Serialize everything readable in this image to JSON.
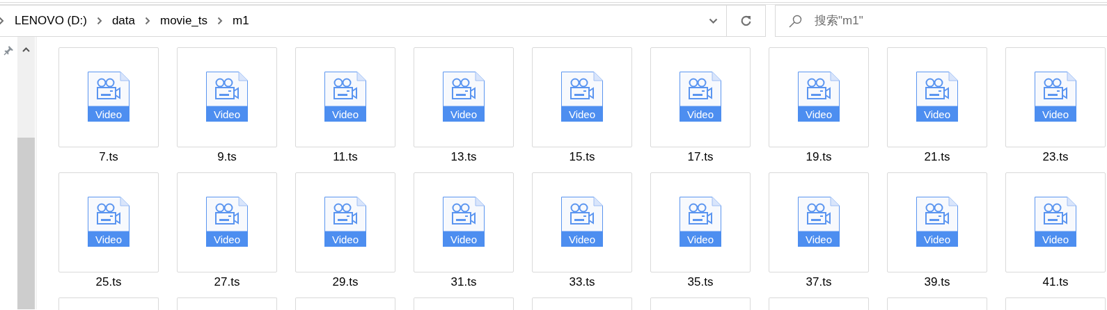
{
  "address_bar": {
    "crumbs": [
      "LENOVO (D:)",
      "data",
      "movie_ts",
      "m1"
    ]
  },
  "search": {
    "placeholder": "搜索\"m1\""
  },
  "files": [
    {
      "kind": "video",
      "name": "7.ts",
      "badge": "Video"
    },
    {
      "kind": "video",
      "name": "9.ts",
      "badge": "Video"
    },
    {
      "kind": "video",
      "name": "11.ts",
      "badge": "Video"
    },
    {
      "kind": "video",
      "name": "13.ts",
      "badge": "Video"
    },
    {
      "kind": "video",
      "name": "15.ts",
      "badge": "Video"
    },
    {
      "kind": "video",
      "name": "17.ts",
      "badge": "Video"
    },
    {
      "kind": "video",
      "name": "19.ts",
      "badge": "Video"
    },
    {
      "kind": "video",
      "name": "21.ts",
      "badge": "Video"
    },
    {
      "kind": "video",
      "name": "23.ts",
      "badge": "Video"
    },
    {
      "kind": "video",
      "name": "25.ts",
      "badge": "Video"
    },
    {
      "kind": "video",
      "name": "27.ts",
      "badge": "Video"
    },
    {
      "kind": "video",
      "name": "29.ts",
      "badge": "Video"
    },
    {
      "kind": "video",
      "name": "31.ts",
      "badge": "Video"
    },
    {
      "kind": "video",
      "name": "33.ts",
      "badge": "Video"
    },
    {
      "kind": "video",
      "name": "35.ts",
      "badge": "Video"
    },
    {
      "kind": "video",
      "name": "37.ts",
      "badge": "Video"
    },
    {
      "kind": "video",
      "name": "39.ts",
      "badge": "Video"
    },
    {
      "kind": "video",
      "name": "41.ts",
      "badge": "Video"
    },
    {
      "kind": "cut"
    },
    {
      "kind": "cut"
    },
    {
      "kind": "cut"
    },
    {
      "kind": "cut"
    },
    {
      "kind": "cut"
    },
    {
      "kind": "cut"
    },
    {
      "kind": "cut"
    },
    {
      "kind": "cut"
    },
    {
      "kind": "cut"
    }
  ]
}
